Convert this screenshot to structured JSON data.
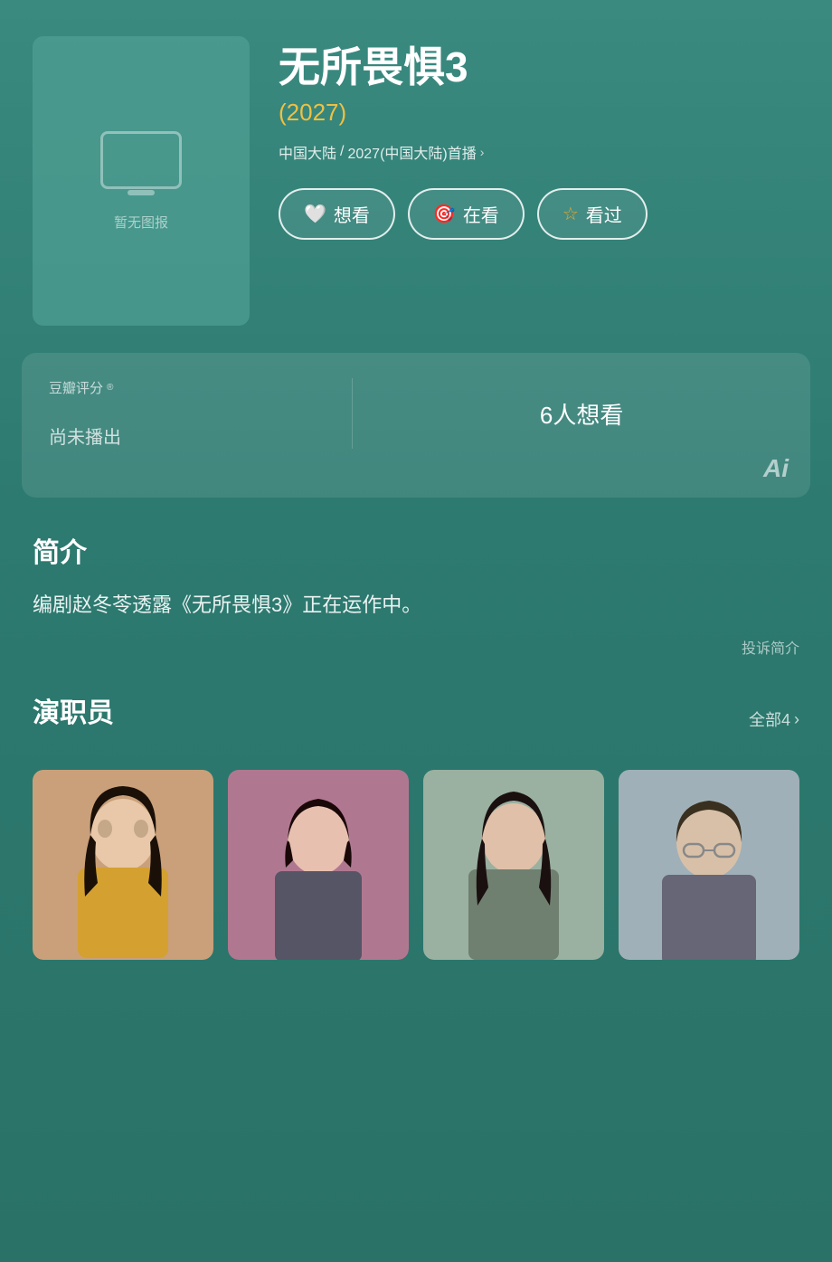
{
  "header": {
    "poster_no_img": "暂无图报",
    "title": "无所畏惧3",
    "year": "(2027)",
    "meta_region": "中国大陆",
    "meta_year": "2027(中国大陆)首播",
    "meta_arrow": "›"
  },
  "buttons": {
    "want": "想看",
    "watching": "在看",
    "watched": "看过"
  },
  "rating": {
    "label": "豆瓣评分",
    "sup": "®",
    "not_aired": "尚未播出",
    "want_count": "6人想看"
  },
  "description": {
    "title": "简介",
    "text": "编剧赵冬苓透露《无所畏惧3》正在运作中。",
    "complaint": "投诉简介"
  },
  "cast": {
    "title": "演职员",
    "all_label": "全部4",
    "arrow": "›"
  }
}
